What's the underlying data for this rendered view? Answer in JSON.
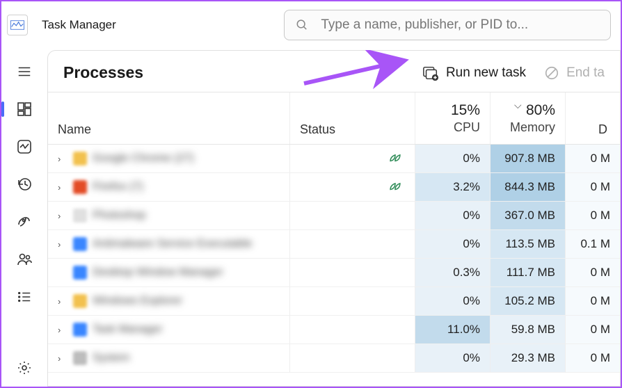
{
  "app": {
    "title": "Task Manager"
  },
  "search": {
    "placeholder": "Type a name, publisher, or PID to..."
  },
  "panel": {
    "title": "Processes",
    "run_new_task": "Run new task",
    "end_task": "End ta"
  },
  "columns": {
    "name": "Name",
    "status": "Status",
    "cpu_pct": "15%",
    "cpu_label": "CPU",
    "mem_pct": "80%",
    "mem_label": "Memory",
    "disk_label": "D"
  },
  "processes": [
    {
      "expandable": true,
      "icon_color": "#f2c14e",
      "label": "Google Chrome (27)",
      "leaf": true,
      "cpu": "0%",
      "cpu_heat": 1,
      "mem": "907.8 MB",
      "mem_heat": 4,
      "disk": "0 M"
    },
    {
      "expandable": true,
      "icon_color": "#e34c26",
      "label": "Firefox (7)",
      "leaf": true,
      "cpu": "3.2%",
      "cpu_heat": 2,
      "mem": "844.3 MB",
      "mem_heat": 4,
      "disk": "0 M"
    },
    {
      "expandable": true,
      "icon_color": "#e0e0e0",
      "label": "Photoshop",
      "leaf": false,
      "cpu": "0%",
      "cpu_heat": 1,
      "mem": "367.0 MB",
      "mem_heat": 3,
      "disk": "0 M"
    },
    {
      "expandable": true,
      "icon_color": "#3a86ff",
      "label": "Antimalware Service Executable",
      "leaf": false,
      "cpu": "0%",
      "cpu_heat": 1,
      "mem": "113.5 MB",
      "mem_heat": 2,
      "disk": "0.1 M"
    },
    {
      "expandable": false,
      "icon_color": "#3a86ff",
      "label": "Desktop Window Manager",
      "leaf": false,
      "cpu": "0.3%",
      "cpu_heat": 1,
      "mem": "111.7 MB",
      "mem_heat": 2,
      "disk": "0 M"
    },
    {
      "expandable": true,
      "icon_color": "#f2c14e",
      "label": "Windows Explorer",
      "leaf": false,
      "cpu": "0%",
      "cpu_heat": 1,
      "mem": "105.2 MB",
      "mem_heat": 2,
      "disk": "0 M"
    },
    {
      "expandable": true,
      "icon_color": "#3a86ff",
      "label": "Task Manager",
      "leaf": false,
      "cpu": "11.0%",
      "cpu_heat": 3,
      "mem": "59.8 MB",
      "mem_heat": 1,
      "disk": "0 M"
    },
    {
      "expandable": true,
      "icon_color": "#bdbdbd",
      "label": "System",
      "leaf": false,
      "cpu": "0%",
      "cpu_heat": 1,
      "mem": "29.3 MB",
      "mem_heat": 1,
      "disk": "0 M"
    }
  ]
}
